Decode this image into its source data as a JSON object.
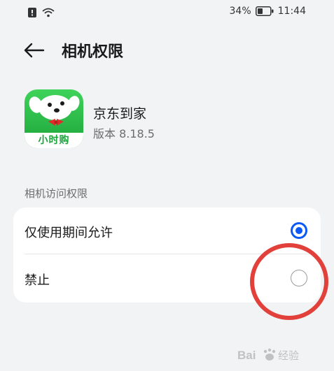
{
  "status_bar": {
    "battery_percent": "34%",
    "time": "11:44",
    "icons": [
      "notification-icon",
      "wifi-icon",
      "battery-icon"
    ]
  },
  "header": {
    "back_icon": "back-arrow-icon",
    "title": "相机权限"
  },
  "app": {
    "name": "京东到家",
    "version": "版本 8.18.5",
    "icon_label": "小时购",
    "icon_colors": {
      "top": "#3fd35a",
      "bottom": "#1ca43a",
      "label_text": "#1aa33a"
    }
  },
  "section": {
    "label": "相机访问权限"
  },
  "options": [
    {
      "label": "仅使用期间允许",
      "selected": true
    },
    {
      "label": "禁止",
      "selected": false
    }
  ],
  "colors": {
    "accent": "#0a59f7",
    "annotation": "#e2403a",
    "background": "#f1f3f5",
    "card": "#ffffff"
  },
  "watermark": {
    "text": "Bai度经验"
  }
}
